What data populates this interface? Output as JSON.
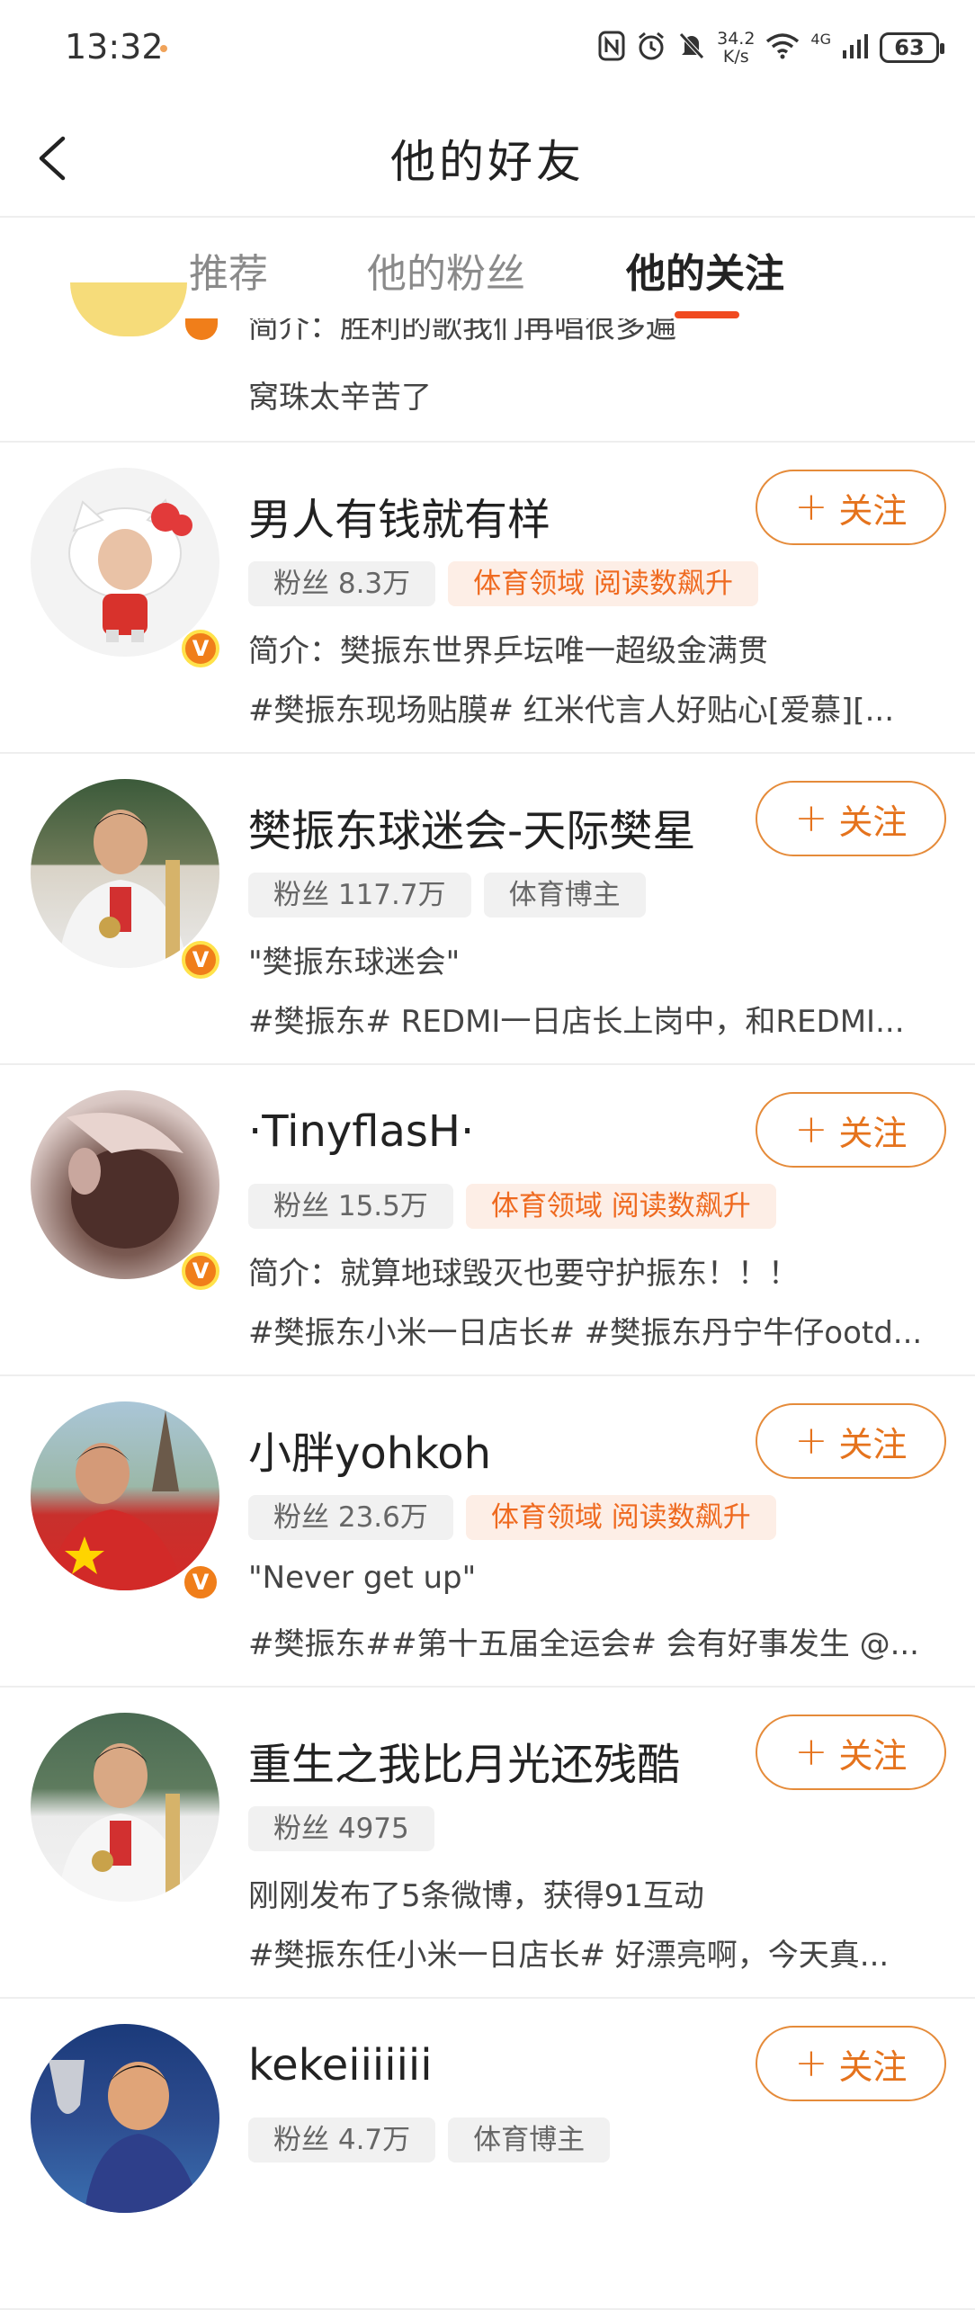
{
  "status_bar": {
    "time": "13:32",
    "speed_value": "34.2",
    "speed_unit": "K/s",
    "network": "4G",
    "battery": "63",
    "icons": [
      "nfc-icon",
      "alarm-icon",
      "mute-icon",
      "wifi-icon",
      "signal-icon",
      "battery-icon"
    ]
  },
  "header": {
    "back_icon": "chevron-left-icon",
    "title": "他的好友"
  },
  "tabs": [
    {
      "label": "推荐",
      "active": false
    },
    {
      "label": "他的粉丝",
      "active": false
    },
    {
      "label": "他的关注",
      "active": true
    }
  ],
  "partial_item": {
    "bio": "简介：胜利的歌我们再唱很多遍",
    "topic": "窝珠太辛苦了"
  },
  "users": [
    {
      "name": "男人有钱就有样",
      "follow": "关注",
      "fans": "粉丝 8.3万",
      "tags": [
        "体育领域 阅读数飙升"
      ],
      "bio": "简介：樊振东世界乒坛唯一超级金满贯",
      "topic": "#樊振东现场贴膜# 红米代言人好贴心[爱慕][...",
      "verified": "V"
    },
    {
      "name": "樊振东球迷会-天际樊星",
      "follow": "关注",
      "fans": "粉丝 117.7万",
      "tags": [
        "体育博主"
      ],
      "bio": "\"樊振东球迷会\"",
      "topic": "#樊振东# REDMI一日店长上岗中，和REDMI...",
      "verified": "V"
    },
    {
      "name": "·TinyflasH·",
      "follow": "关注",
      "fans": "粉丝 15.5万",
      "tags": [
        "体育领域 阅读数飙升"
      ],
      "bio": "简介：就算地球毁灭也要守护振东！！！",
      "topic": "#樊振东小米一日店长# #樊振东丹宁牛仔ootd...",
      "verified": "V"
    },
    {
      "name": "小胖yohkoh",
      "follow": "关注",
      "fans": "粉丝 23.6万",
      "tags": [
        "体育领域 阅读数飙升"
      ],
      "bio": "\"Never get up\"",
      "topic": "#樊振东##第十五届全运会# 会有好事发生 @...",
      "verified": "V"
    },
    {
      "name": "重生之我比月光还残酷",
      "follow": "关注",
      "fans": "粉丝 4975",
      "tags": [],
      "bio": "刚刚发布了5条微博，获得91互动",
      "topic": "#樊振东任小米一日店长# 好漂亮啊，今天真...",
      "verified": ""
    },
    {
      "name": "kekeiiiiiii",
      "follow": "关注",
      "fans": "粉丝 4.7万",
      "tags": [
        "体育博主"
      ],
      "bio": "",
      "topic": "",
      "verified": ""
    }
  ],
  "colors": {
    "accent": "#e5731d",
    "tab_indicator": "#f04a20",
    "hot_tag_bg": "#fdeee6",
    "verified_badge": "#f07e1a"
  }
}
